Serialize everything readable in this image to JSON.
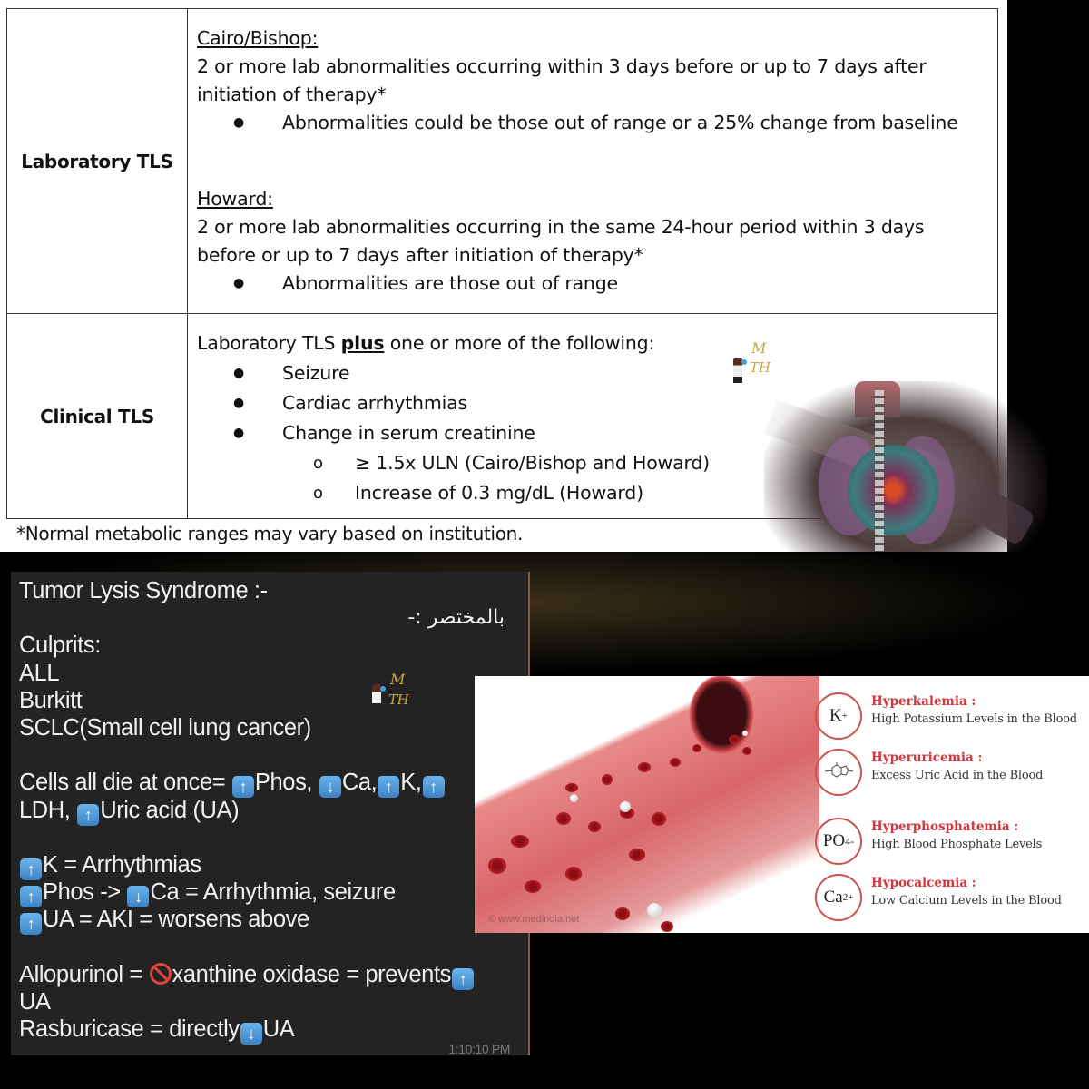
{
  "tls_table": {
    "laboratory": {
      "header": "Laboratory TLS",
      "cairo_bishop": {
        "title": "Cairo/Bishop:",
        "line1": "2 or more lab abnormalities occurring within 3 days before or up to 7 days after",
        "line2": "initiation of therapy*",
        "bullet": "Abnormalities could be those out of range or a 25% change from baseline"
      },
      "howard": {
        "title": "Howard:",
        "line1": "2 or more lab abnormalities occurring in the same 24-hour period within 3 days",
        "line2": "before or up to 7 days after initiation of therapy*",
        "bullet": "Abnormalities are those out of range"
      }
    },
    "clinical": {
      "header": "Clinical TLS",
      "intro_pre": "Laboratory TLS ",
      "intro_bold": "plus",
      "intro_post": " one or more of the following:",
      "bullets": [
        "Seizure",
        "Cardiac arrhythmias",
        "Change in serum creatinine"
      ],
      "sub_bullets": [
        "≥ 1.5x ULN (Cairo/Bishop and Howard)",
        "Increase of 0.3 mg/dL (Howard)"
      ]
    },
    "footnote": "*Normal metabolic ranges may vary based on institution."
  },
  "watermark": {
    "line1": "M",
    "line2": "TH"
  },
  "chat_note": {
    "title": "Tumor Lysis Syndrome :-",
    "arabic": "بالمختصر :-",
    "culprits_label": "Culprits:",
    "culprits": [
      "ALL",
      "Burkitt",
      "SCLC(Small cell lung cancer)"
    ],
    "cells_line1": {
      "pre": "Cells all die at once= ",
      "a": "Phos, ",
      "b": "Ca,",
      "c": "K,",
      "d": ""
    },
    "cells_line2": {
      "a": "LDH, ",
      "b": "Uric acid (UA)"
    },
    "effects": [
      {
        "t1": "K = Arrhythmias"
      },
      {
        "t1": "Phos -> ",
        "t2": "Ca = Arrhythmia, seizure"
      },
      {
        "t1": "UA = AKI = worsens above"
      }
    ],
    "allopurinol": {
      "pre": "Allopurinol = ",
      "mid": "xanthine oxidase = prevents",
      "post": "UA"
    },
    "rasburicase": {
      "pre": "Rasburicase = directly",
      "post": "UA"
    },
    "timestamp": "1:10:10 PM",
    "icons": {
      "up": "↑",
      "down": "↓"
    }
  },
  "infographic": {
    "credit": "© www.medindia.net",
    "items": [
      {
        "symbol": "K",
        "sup": "+",
        "title": "Hyperkalemia :",
        "desc": "High Potassium Levels in the Blood"
      },
      {
        "symbol": "",
        "title": "Hyperuricemia :",
        "desc": "Excess Uric Acid in the Blood"
      },
      {
        "symbol": "PO",
        "sub": "4-",
        "title": "Hyperphosphatemia :",
        "desc": "High Blood Phosphate Levels"
      },
      {
        "symbol": "Ca",
        "sup": "2+",
        "title": "Hypocalcemia :",
        "desc": "Low Calcium Levels in the Blood"
      }
    ],
    "accent": "#d0373f"
  }
}
